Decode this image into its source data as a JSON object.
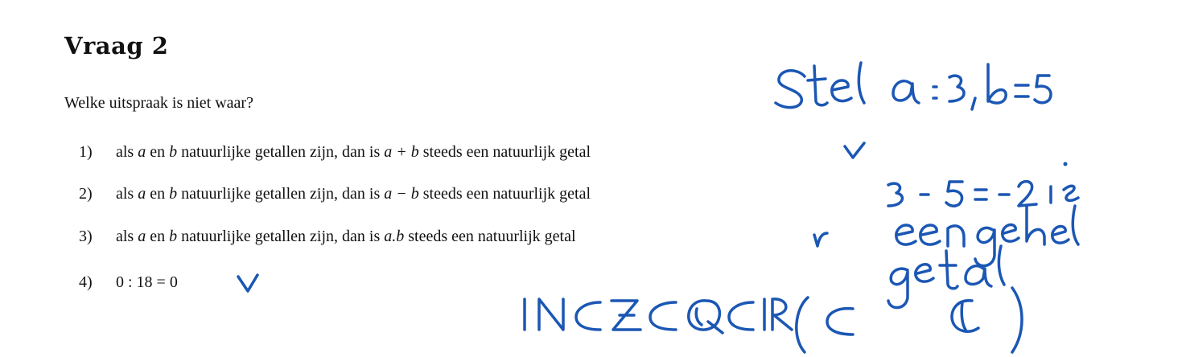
{
  "title": "Vraag 2",
  "question": "Welke uitspraak is niet waar?",
  "options": [
    {
      "number": "1)",
      "text_before": "als ",
      "var_a": "a",
      "text_en": " en ",
      "var_b": "b",
      "text_mid": " natuurlijke getallen zijn, dan is ",
      "expression": "a + b",
      "text_after": " steeds een natuurlijk getal"
    },
    {
      "number": "2)",
      "text_before": "als ",
      "var_a": "a",
      "text_en": " en ",
      "var_b": "b",
      "text_mid": " natuurlijke getallen zijn, dan is ",
      "expression": "a − b",
      "text_after": " steeds een natuurlijk getal"
    },
    {
      "number": "3)",
      "text_before": "als ",
      "var_a": "a",
      "text_en": " en ",
      "var_b": "b",
      "text_mid": " natuurlijke getallen zijn, dan is ",
      "expression": "a.b",
      "text_after": " steeds een natuurlijk getal"
    },
    {
      "number": "4)",
      "expression": "0 : 18 = 0"
    }
  ],
  "handwriting": {
    "ink_color": "#1b57b4",
    "note_1": "Stel a=3, b=5",
    "note_2": "3 - 5 = -2 is een geheel getal",
    "note_3": "ℕ ⊂ ℤ ⊂ ℚ ⊂ ℝ (⊂ ℂ)",
    "checkmarks": [
      "option-1",
      "option-3",
      "option-4"
    ]
  }
}
